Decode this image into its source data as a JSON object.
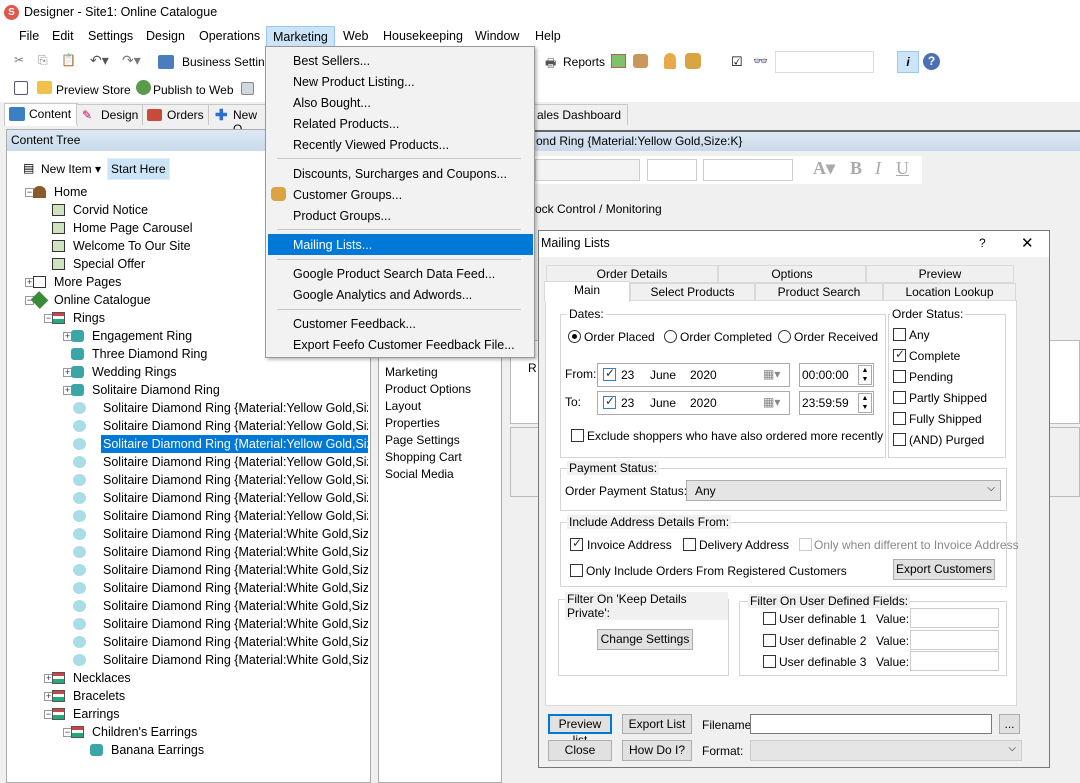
{
  "window": {
    "title": "Designer - Site1: Online Catalogue",
    "logo_color": "#e0584a"
  },
  "menu": [
    "File",
    "Edit",
    "Settings",
    "Design",
    "Operations",
    "Marketing",
    "Web",
    "Housekeeping",
    "Window",
    "Help"
  ],
  "toolbar": {
    "business_settings": "Business Setting",
    "reports": "Reports",
    "preview_store": "Preview Store",
    "publish": "Publish to Web"
  },
  "tabs": [
    "Content",
    "Design",
    "Orders",
    "New O",
    "ales Dashboard"
  ],
  "content_tree": {
    "title": "Content Tree",
    "new_item": "New Item",
    "start_here": "Start Here",
    "items": [
      {
        "label": "Home",
        "level": 0,
        "exp": "-",
        "icon": "home-icon"
      },
      {
        "label": "Corvid Notice",
        "level": 1,
        "icon": "page-icon"
      },
      {
        "label": "Home Page Carousel",
        "level": 1,
        "icon": "page-icon"
      },
      {
        "label": "Welcome To Our Site",
        "level": 1,
        "icon": "page-icon"
      },
      {
        "label": "Special Offer",
        "level": 1,
        "icon": "page-icon"
      },
      {
        "label": "More Pages",
        "level": 0,
        "exp": "+",
        "icon": "list-icon"
      },
      {
        "label": "Online Catalogue",
        "level": 0,
        "exp": "-",
        "icon": "catalogue-icon"
      },
      {
        "label": "Rings",
        "level": 1,
        "exp": "-",
        "icon": "section-icon"
      },
      {
        "label": "Engagement Ring",
        "level": 2,
        "exp": "+",
        "icon": "product-icon"
      },
      {
        "label": "Three Diamond Ring",
        "level": 2,
        "icon": "product-icon"
      },
      {
        "label": "Wedding Rings",
        "level": 2,
        "exp": "+",
        "icon": "product-icon"
      },
      {
        "label": "Solitaire Diamond Ring",
        "level": 2,
        "exp": "+",
        "icon": "product-icon"
      },
      {
        "label": "Solitaire Diamond Ring {Material:Yellow Gold,Size",
        "level": 3,
        "icon": "variant-icon"
      },
      {
        "label": "Solitaire Diamond Ring {Material:Yellow Gold,Size",
        "level": 3,
        "icon": "variant-icon"
      },
      {
        "label": "Solitaire Diamond Ring {Material:Yellow Gold,Size",
        "level": 3,
        "icon": "variant-icon",
        "selected": true
      },
      {
        "label": "Solitaire Diamond Ring {Material:Yellow Gold,Size",
        "level": 3,
        "icon": "variant-icon"
      },
      {
        "label": "Solitaire Diamond Ring {Material:Yellow Gold,Size",
        "level": 3,
        "icon": "variant-icon"
      },
      {
        "label": "Solitaire Diamond Ring {Material:Yellow Gold,Size",
        "level": 3,
        "icon": "variant-icon"
      },
      {
        "label": "Solitaire Diamond Ring {Material:Yellow Gold,Size",
        "level": 3,
        "icon": "variant-icon"
      },
      {
        "label": "Solitaire Diamond Ring {Material:White Gold,Size:",
        "level": 3,
        "icon": "variant-icon"
      },
      {
        "label": "Solitaire Diamond Ring {Material:White Gold,Size:",
        "level": 3,
        "icon": "variant-icon"
      },
      {
        "label": "Solitaire Diamond Ring {Material:White Gold,Size:",
        "level": 3,
        "icon": "variant-icon"
      },
      {
        "label": "Solitaire Diamond Ring {Material:White Gold,Size:",
        "level": 3,
        "icon": "variant-icon"
      },
      {
        "label": "Solitaire Diamond Ring {Material:White Gold,Size:",
        "level": 3,
        "icon": "variant-icon"
      },
      {
        "label": "Solitaire Diamond Ring {Material:White Gold,Size:",
        "level": 3,
        "icon": "variant-icon"
      },
      {
        "label": "Solitaire Diamond Ring {Material:White Gold,Size:",
        "level": 3,
        "icon": "variant-icon"
      },
      {
        "label": "Solitaire Diamond Ring {Material:White Gold,Size:",
        "level": 3,
        "icon": "variant-icon"
      },
      {
        "label": "Necklaces",
        "level": 1,
        "exp": "+",
        "icon": "section-icon"
      },
      {
        "label": "Bracelets",
        "level": 1,
        "exp": "+",
        "icon": "section-icon"
      },
      {
        "label": "Earrings",
        "level": 1,
        "exp": "-",
        "icon": "section-icon"
      },
      {
        "label": "Children's Earrings",
        "level": 2,
        "exp": "-",
        "icon": "section-icon"
      },
      {
        "label": "Banana Earrings",
        "level": 3,
        "icon": "product-icon"
      }
    ]
  },
  "editor": {
    "header": "ond Ring {Material:Yellow Gold,Size:K}",
    "section": "ock Control / Monitoring",
    "r_label": "R",
    "properties_list": [
      "Marketing",
      "Product Options",
      "Layout",
      "Properties",
      "Page Settings",
      "Shopping Cart",
      "Social Media"
    ]
  },
  "marketing_menu": {
    "items": [
      "Best Sellers...",
      "New Product Listing...",
      "Also Bought...",
      "Related Products...",
      "Recently Viewed Products...",
      "Discounts, Surcharges and Coupons...",
      "Customer Groups...",
      "Product Groups...",
      "Mailing Lists...",
      "Google Product Search Data Feed...",
      "Google Analytics and Adwords...",
      "Customer Feedback...",
      "Export Feefo Customer Feedback File..."
    ],
    "highlighted": "Mailing Lists..."
  },
  "dialog": {
    "title": "Mailing Lists",
    "help": "?",
    "close": "✕",
    "tabs_row1": [
      "Order Details",
      "Options",
      "Preview"
    ],
    "tabs_row2": [
      "Main",
      "Select Products",
      "Product Search",
      "Location Lookup"
    ],
    "active_tab": "Main",
    "dates": {
      "label": "Dates:",
      "radios": [
        "Order Placed",
        "Order Completed",
        "Order Received"
      ],
      "selected": "Order Placed",
      "from_label": "From:",
      "to_label": "To:",
      "from": {
        "day": "23",
        "month": "June",
        "year": "2020",
        "time": "00:00:00",
        "checked": true
      },
      "to": {
        "day": "23",
        "month": "June",
        "year": "2020",
        "time": "23:59:59",
        "checked": true
      },
      "exclude": "Exclude shoppers who have also ordered more recently"
    },
    "order_status": {
      "label": "Order Status:",
      "options": [
        {
          "label": "Any",
          "checked": false
        },
        {
          "label": "Complete",
          "checked": true
        },
        {
          "label": "Pending",
          "checked": false
        },
        {
          "label": "Partly Shipped",
          "checked": false
        },
        {
          "label": "Fully Shipped",
          "checked": false
        },
        {
          "label": "(AND) Purged",
          "checked": false
        }
      ]
    },
    "payment": {
      "label": "Payment Status:",
      "field_label": "Order Payment Status:",
      "value": "Any"
    },
    "address": {
      "label": "Include Address Details From:",
      "invoice": "Invoice Address",
      "delivery": "Delivery Address",
      "only_different": "Only when different to Invoice Address",
      "registered": "Only Include Orders From Registered Customers",
      "export_btn": "Export Customers"
    },
    "private": {
      "label": "Filter On 'Keep Details Private':",
      "btn": "Change Settings"
    },
    "user_defined": {
      "label": "Filter On User Defined Fields:",
      "value_label": "Value:",
      "fields": [
        "User definable 1",
        "User definable 2",
        "User definable 3"
      ]
    },
    "footer": {
      "preview": "Preview list",
      "export": "Export List",
      "filename": "Filename:",
      "browse": "...",
      "close": "Close",
      "howdoi": "How Do I?",
      "format": "Format:"
    }
  }
}
